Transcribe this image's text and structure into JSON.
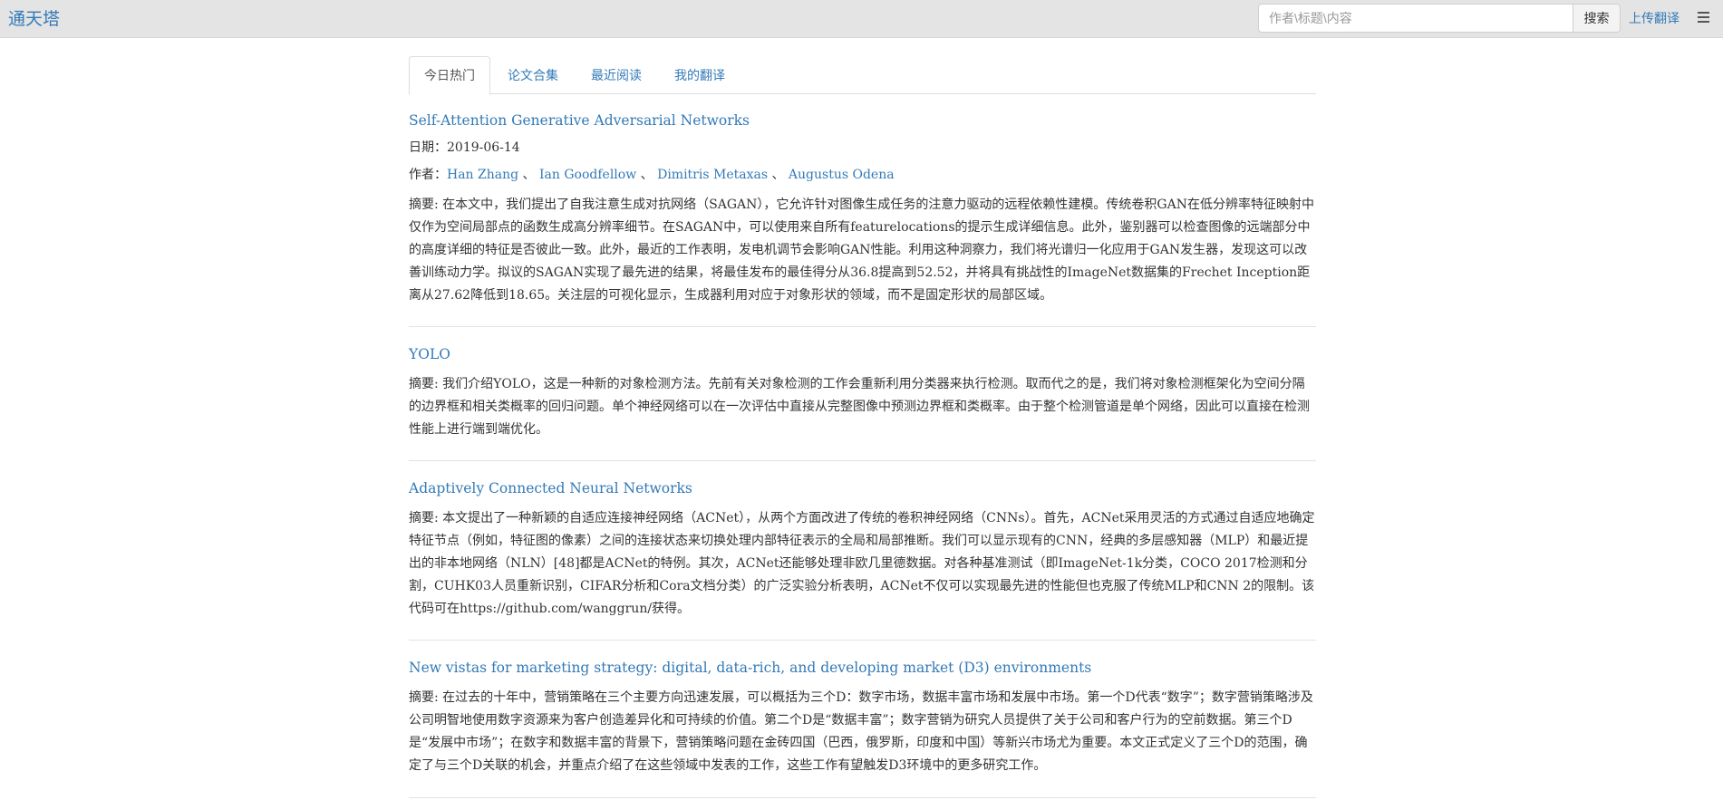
{
  "header": {
    "brand": "通天塔",
    "search_placeholder": "作者\\标题\\内容",
    "search_button": "搜索",
    "upload_link": "上传翻译",
    "menu_icon": "hamburger-menu-icon"
  },
  "tabs": [
    {
      "label": "今日热门",
      "active": true
    },
    {
      "label": "论文合集",
      "active": false
    },
    {
      "label": "最近阅读",
      "active": false
    },
    {
      "label": "我的翻译",
      "active": false
    }
  ],
  "papers": [
    {
      "title": "Self-Attention Generative Adversarial Networks",
      "date_label": "日期：",
      "date": "2019-06-14",
      "authors_label": "作者：",
      "authors": [
        "Han Zhang",
        "Ian Goodfellow",
        "Dimitris Metaxas",
        "Augustus Odena"
      ],
      "author_separator": "、",
      "abstract": "摘要: 在本文中，我们提出了自我注意生成对抗网络（SAGAN），它允许针对图像生成任务的注意力驱动的远程依赖性建模。传统卷积GAN在低分辨率特征映射中仅作为空间局部点的函数生成高分辨率细节。在SAGAN中，可以使用来自所有featurelocations的提示生成详细信息。此外，鉴别器可以检查图像的远端部分中的高度详细的特征是否彼此一致。此外，最近的工作表明，发电机调节会影响GAN性能。利用这种洞察力，我们将光谱归一化应用于GAN发生器，发现这可以改善训练动力学。拟议的SAGAN实现了最先进的结果，将最佳发布的最佳得分从36.8提高到52.52，并将具有挑战性的ImageNet数据集的Frechet Inception距离从27.62降低到18.65。关注层的可视化显示，生成器利用对应于对象形状的领域，而不是固定形状的局部区域。"
    },
    {
      "title": "YOLO",
      "abstract": "摘要: 我们介绍YOLO，这是一种新的对象检测方法。先前有关对象检测的工作会重新利用分类器来执行检测。取而代之的是，我们将对象检测框架化为空间分隔的边界框和相关类概率的回归问题。单个神经网络可以在一次评估中直接从完整图像中预测边界框和类概率。由于整个检测管道是单个网络，因此可以直接在检测性能上进行端到端优化。"
    },
    {
      "title": "Adaptively Connected Neural Networks",
      "abstract": "摘要: 本文提出了一种新颖的自适应连接神经网络（ACNet），从两个方面改进了传统的卷积神经网络（CNNs）。首先，ACNet采用灵活的方式通过自适应地确定特征节点（例如，特征图的像素）之间的连接状态来切换处理内部特征表示的全局和局部推断。我们可以显示现有的CNN，经典的多层感知器（MLP）和最近提出的非本地网络（NLN）[48]都是ACNet的特例。其次，ACNet还能够处理非欧几里德数据。对各种基准测试（即ImageNet-1k分类，COCO 2017检测和分割，CUHK03人员重新识别，CIFAR分析和Cora文档分类）的广泛实验分析表明，ACNet不仅可以实现最先进的性能但也克服了传统MLP和CNN 2的限制。该代码可在https://github.com/wanggrun/获得。"
    },
    {
      "title": "New vistas for marketing strategy: digital, data-rich, and developing market (D3) environments",
      "abstract": "摘要: 在过去的十年中，营销策略在三个主要方向迅速发展，可以概括为三个D：数字市场，数据丰富市场和发展中市场。第一个D代表“数字”；数字营销策略涉及公司明智地使用数字资源来为客户创造差异化和可持续的价值。第二个D是“数据丰富”；数字营销为研究人员提供了关于公司和客户行为的空前数据。第三个D是“发展中市场”；在数字和数据丰富的背景下，营销策略问题在金砖四国（巴西，俄罗斯，印度和中国）等新兴市场尤为重要。本文正式定义了三个D的范围，确定了与三个D关联的机会，并重点介绍了在这些领域中发表的工作，这些工作有望触发D3环境中的更多研究工作。"
    }
  ]
}
